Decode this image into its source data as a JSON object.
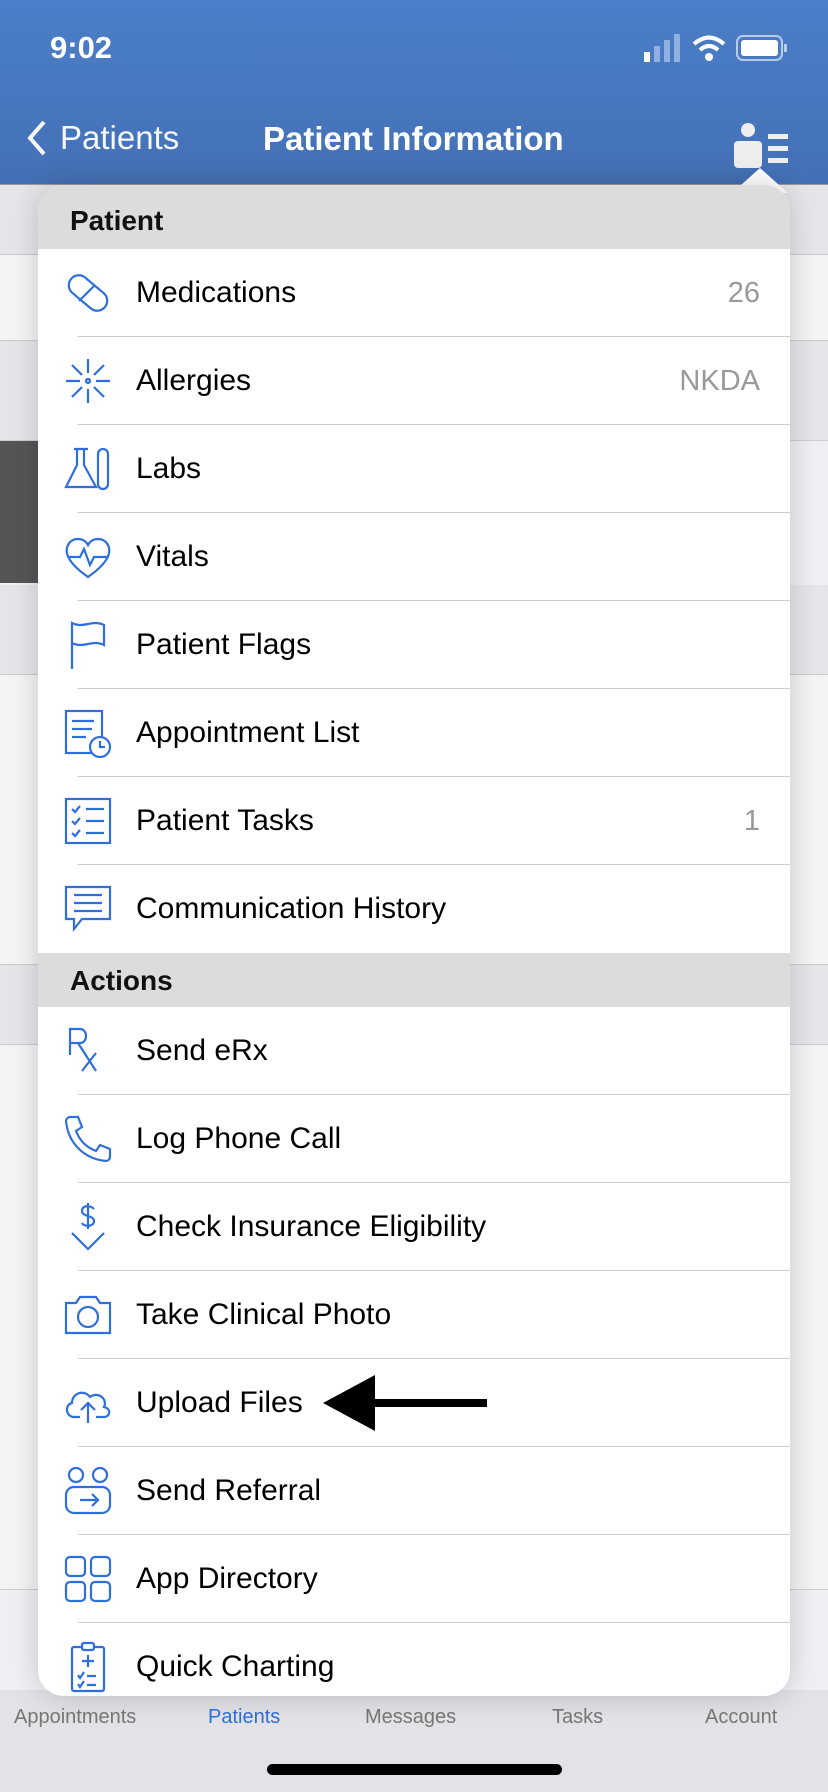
{
  "status_bar": {
    "time": "9:02"
  },
  "nav": {
    "back_label": "Patients",
    "title": "Patient Information"
  },
  "menu": {
    "patient_header": "Patient",
    "patient_items": [
      {
        "label": "Medications",
        "value": "26",
        "icon": "pill-icon"
      },
      {
        "label": "Allergies",
        "value": "NKDA",
        "icon": "allergy-burst-icon"
      },
      {
        "label": "Labs",
        "value": "",
        "icon": "flask-icon"
      },
      {
        "label": "Vitals",
        "value": "",
        "icon": "heart-pulse-icon"
      },
      {
        "label": "Patient Flags",
        "value": "",
        "icon": "flag-icon"
      },
      {
        "label": "Appointment List",
        "value": "",
        "icon": "list-clock-icon"
      },
      {
        "label": "Patient Tasks",
        "value": "1",
        "icon": "checklist-icon"
      },
      {
        "label": "Communication History",
        "value": "",
        "icon": "chat-bubble-icon"
      }
    ],
    "actions_header": "Actions",
    "action_items": [
      {
        "label": "Send eRx",
        "icon": "rx-icon"
      },
      {
        "label": "Log Phone Call",
        "icon": "phone-icon"
      },
      {
        "label": "Check Insurance Eligibility",
        "icon": "dollar-check-icon"
      },
      {
        "label": "Take Clinical Photo",
        "icon": "camera-icon"
      },
      {
        "label": "Upload Files",
        "icon": "cloud-upload-icon"
      },
      {
        "label": "Send Referral",
        "icon": "referral-icon"
      },
      {
        "label": "App Directory",
        "icon": "grid-icon"
      },
      {
        "label": "Quick Charting",
        "icon": "clipboard-icon"
      }
    ]
  },
  "tabbar": {
    "tabs": [
      {
        "label": "Appointments"
      },
      {
        "label": "Patients",
        "active": true
      },
      {
        "label": "Messages"
      },
      {
        "label": "Tasks"
      },
      {
        "label": "Account"
      }
    ]
  },
  "colors": {
    "header": "#4b7fc9",
    "accent": "#2f6fdd"
  }
}
